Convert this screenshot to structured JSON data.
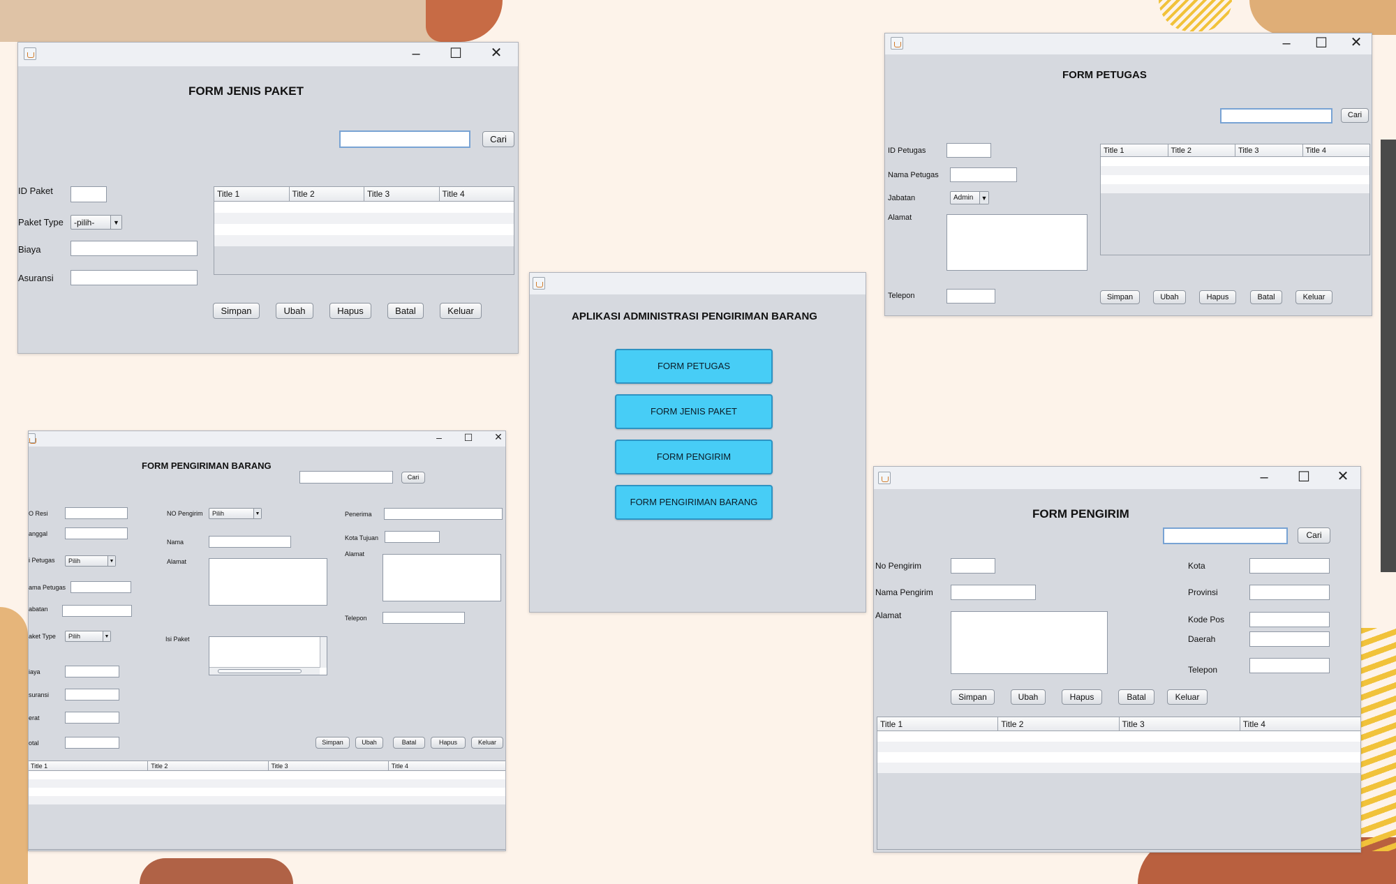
{
  "windows": {
    "jenis_paket": {
      "title": "FORM JENIS PAKET",
      "labels": {
        "id": "ID Paket",
        "type": "Paket Type",
        "biaya": "Biaya",
        "asuransi": "Asuransi"
      },
      "search_label": "Cari",
      "type_value": "-pilih-",
      "table_headers": [
        "Title 1",
        "Title 2",
        "Title 3",
        "Title 4"
      ],
      "buttons": {
        "simpan": "Simpan",
        "ubah": "Ubah",
        "hapus": "Hapus",
        "batal": "Batal",
        "keluar": "Keluar"
      }
    },
    "menu": {
      "title": "APLIKASI ADMINISTRASI PENGIRIMAN BARANG",
      "buttons": [
        "FORM PETUGAS",
        "FORM JENIS PAKET",
        "FORM PENGIRIM",
        "FORM PENGIRIMAN BARANG"
      ]
    },
    "petugas": {
      "title": "FORM PETUGAS",
      "search_label": "Cari",
      "labels": {
        "id": "ID Petugas",
        "nama": "Nama Petugas",
        "jabatan": "Jabatan",
        "alamat": "Alamat",
        "telepon": "Telepon"
      },
      "jabatan_value": "Admin",
      "table_headers": [
        "Title 1",
        "Title 2",
        "Title 3",
        "Title 4"
      ],
      "buttons": {
        "simpan": "Simpan",
        "ubah": "Ubah",
        "hapus": "Hapus",
        "batal": "Batal",
        "keluar": "Keluar"
      }
    },
    "pengiriman": {
      "title": "FORM PENGIRIMAN BARANG",
      "search_label": "Cari",
      "left_labels": {
        "resi": "O Resi",
        "tanggal": "anggal",
        "petugas": "i Petugas",
        "nama_petugas": "ama Petugas",
        "jabatan": "abatan",
        "paket_type": "aket Type",
        "biaya": "iaya",
        "asuransi": "suransi",
        "berat": "erat",
        "total": "otal"
      },
      "mid_labels": {
        "no_pengirim": "NO Pengirim",
        "nama": "Nama",
        "alamat": "Alamat",
        "isi_paket": "Isi Paket"
      },
      "right_labels": {
        "penerima": "Penerima",
        "kota_tujuan": "Kota Tujuan",
        "alamat": "Alamat",
        "telepon": "Telepon"
      },
      "combo_value": "Pilih",
      "table_headers": [
        "Title 1",
        "Title 2",
        "Title 3",
        "Title 4"
      ],
      "buttons": {
        "simpan": "Simpan",
        "ubah": "Ubah",
        "batal": "Batal",
        "hapus": "Hapus",
        "keluar": "Keluar"
      }
    },
    "pengirim": {
      "title": "FORM PENGIRIM",
      "search_label": "Cari",
      "left_labels": {
        "no": "No Pengirim",
        "nama": "Nama Pengirim",
        "alamat": "Alamat"
      },
      "right_labels": {
        "kota": "Kota",
        "provinsi": "Provinsi",
        "kode_pos": "Kode Pos",
        "daerah": "Daerah",
        "telepon": "Telepon"
      },
      "table_headers": [
        "Title 1",
        "Title 2",
        "Title 3",
        "Title 4"
      ],
      "buttons": {
        "simpan": "Simpan",
        "ubah": "Ubah",
        "hapus": "Hapus",
        "batal": "Batal",
        "keluar": "Keluar"
      }
    }
  },
  "colors": {
    "background": "#fdf3ea",
    "menu_button": "#47cdf6",
    "window": "#d6d9df"
  },
  "icons": [
    "java-app-icon",
    "minimize-icon",
    "maximize-icon",
    "close-icon",
    "dropdown-arrow-icon"
  ]
}
